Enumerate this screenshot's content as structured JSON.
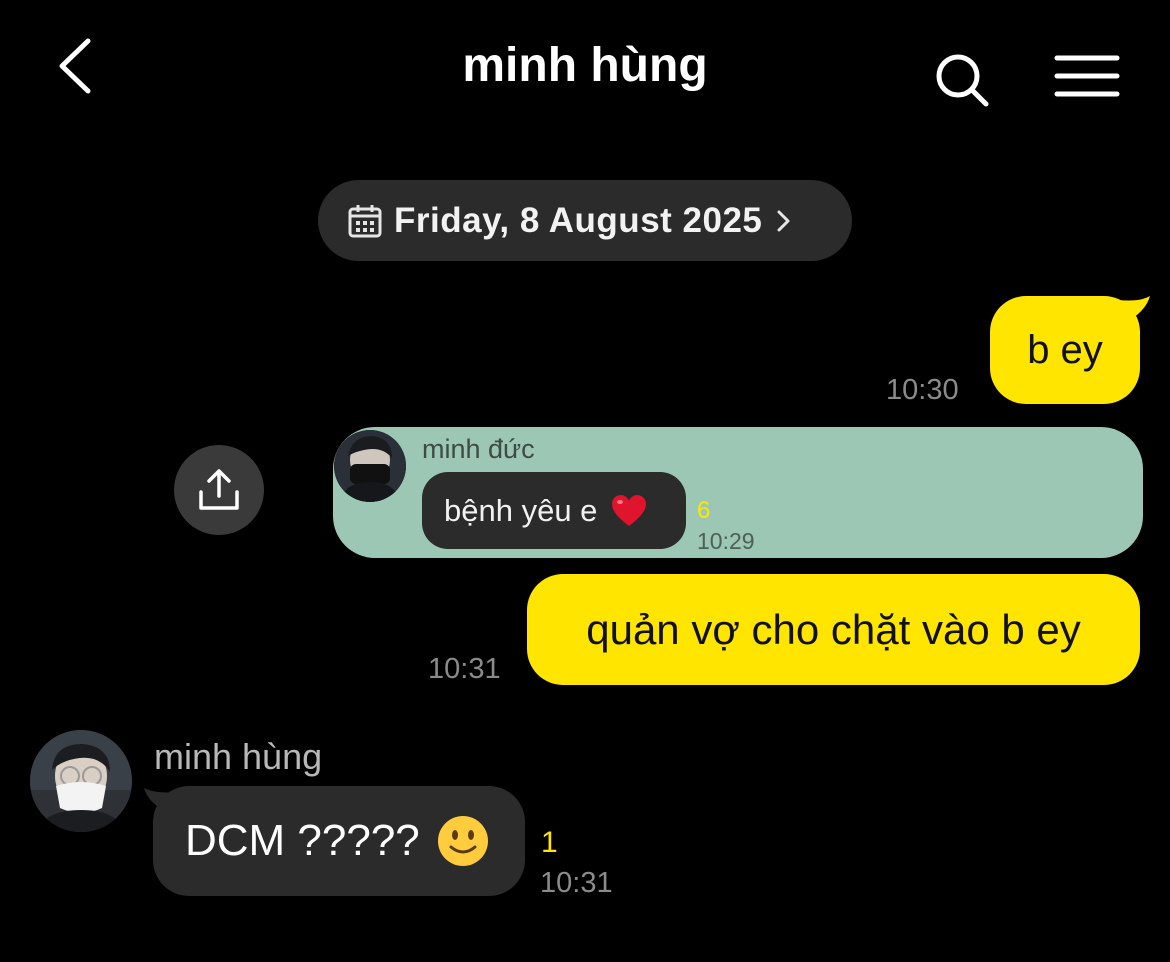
{
  "header": {
    "title": "minh hùng",
    "back_icon": "chevron-left-icon",
    "search_icon": "search-icon",
    "menu_icon": "hamburger-menu-icon"
  },
  "date_divider": {
    "label": "Friday, 8 August 2025",
    "icon": "calendar-icon",
    "chevron": "chevron-right-icon"
  },
  "messages": [
    {
      "type": "outgoing",
      "text": "b ey",
      "time": "10:30"
    },
    {
      "type": "forwarded",
      "share_icon": "share-icon",
      "sender": "minh đức",
      "text": "bệnh yêu e",
      "emoji": "red-heart",
      "unread": "6",
      "time": "10:29"
    },
    {
      "type": "outgoing",
      "text": "quản vợ cho chặt vào b ey",
      "time": "10:31"
    },
    {
      "type": "incoming",
      "sender": "minh hùng",
      "text": "DCM ?????",
      "emoji": "slightly-smiling-face",
      "unread": "1",
      "time": "10:31"
    }
  ],
  "colors": {
    "background": "#000000",
    "outgoing_bubble": "#ffe500",
    "incoming_bubble": "#2b2b2b",
    "forward_card": "#9cc7b5",
    "unread": "#ffe500"
  }
}
